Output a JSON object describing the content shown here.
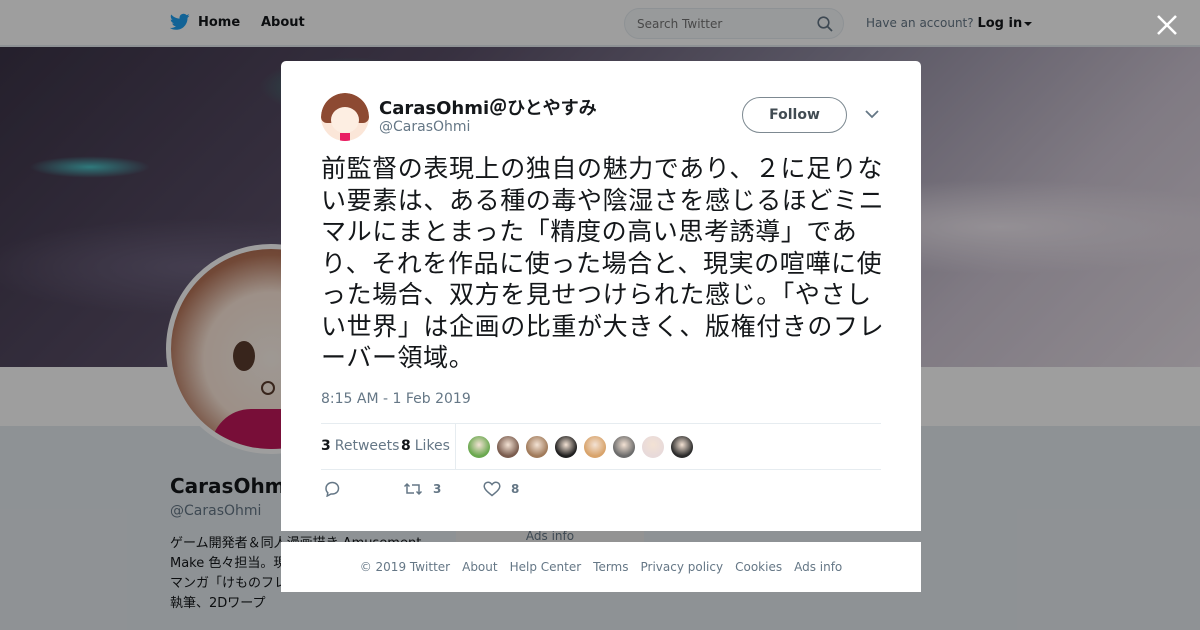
{
  "topbar": {
    "home_label": "Home",
    "about_label": "About",
    "search_placeholder": "Search Twitter",
    "account_prompt": "Have an account?",
    "login_label": "Log in"
  },
  "profile": {
    "name": "CarasOhmi",
    "handle": "@CarasOhmi",
    "bio": "ゲーム開発者＆同人漫画描き Amusement Make 色々担当。現在は 天孔」で、二次創作マンガ「けものフレンズ //（パラレル）」の執筆、2Dワープ"
  },
  "ads_box_label": "Ads info",
  "modal": {
    "display_name": "CarasOhmi＠ひとやすみ",
    "handle": "@CarasOhmi",
    "follow_label": "Follow",
    "tweet_text": "前監督の表現上の独自の魅力であり、２に足りない要素は、ある種の毒や陰湿さを感じるほどミニマルにまとまった「精度の高い思考誘導」であり、それを作品に使った場合と、現実の喧嘩に使った場合、双方を見せつけられた感じ。「やさしい世界」は企画の比重が大きく、版権付きのフレーバー領域。",
    "timestamp": "8:15 AM - 1 Feb 2019",
    "retweet_count": "3",
    "retweet_label": "Retweets",
    "like_count": "8",
    "like_label": "Likes",
    "action_retweet_count": "3",
    "action_like_count": "8",
    "liker_colors": [
      "#6aa84f",
      "#7a5c4e",
      "#a07a5a",
      "#1f1f1f",
      "#d8a36b",
      "#6b6b6b",
      "#e8dada",
      "#2b2b2b"
    ]
  },
  "footer": {
    "copyright": "© 2019 Twitter",
    "about": "About",
    "help": "Help Center",
    "terms": "Terms",
    "privacy": "Privacy policy",
    "cookies": "Cookies",
    "ads": "Ads info"
  },
  "colors": {
    "twitter_blue": "#1da1f2",
    "text_dark": "#14171a",
    "text_gray": "#657786"
  },
  "icons": {
    "brand": "twitter-bird-icon",
    "search": "search-icon",
    "close": "close-icon",
    "caret": "chevron-down-icon",
    "reply": "reply-icon",
    "retweet": "retweet-icon",
    "like": "heart-icon"
  }
}
